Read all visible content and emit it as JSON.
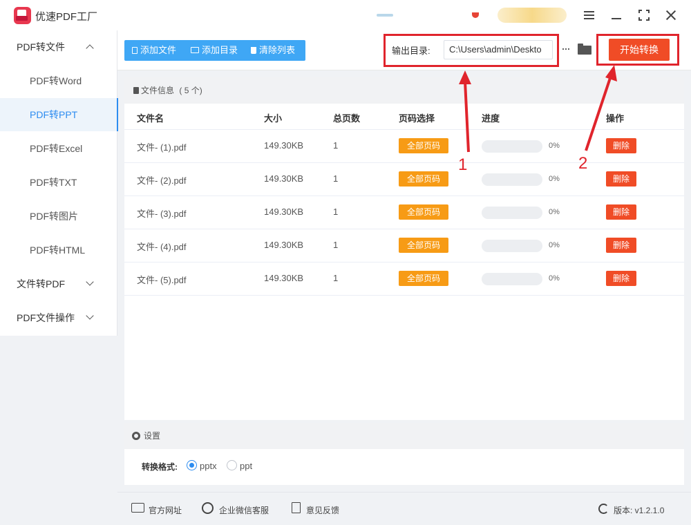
{
  "app": {
    "title": "优速PDF工厂"
  },
  "sidebar": {
    "groups": [
      {
        "label": "PDF转文件",
        "expanded": true,
        "items": [
          {
            "label": "PDF转Word"
          },
          {
            "label": "PDF转PPT",
            "active": true
          },
          {
            "label": "PDF转Excel"
          },
          {
            "label": "PDF转TXT"
          },
          {
            "label": "PDF转图片"
          },
          {
            "label": "PDF转HTML"
          }
        ]
      },
      {
        "label": "文件转PDF",
        "expanded": false
      },
      {
        "label": "PDF文件操作",
        "expanded": false
      }
    ]
  },
  "toolbar": {
    "add_file": "添加文件",
    "add_dir": "添加目录",
    "clear_list": "清除列表",
    "output_label": "输出目录:",
    "output_path": "C:\\Users\\admin\\Deskto",
    "more": "···",
    "start": "开始转换"
  },
  "file_panel": {
    "title": "文件信息",
    "count": "( 5 个)",
    "columns": {
      "name": "文件名",
      "size": "大小",
      "pages": "总页数",
      "page_select": "页码选择",
      "progress": "进度",
      "action": "操作"
    },
    "rows": [
      {
        "name": "文件- (1).pdf",
        "size": "149.30KB",
        "pages": "1",
        "page_select": "全部页码",
        "progress": 0,
        "progress_text": "0%",
        "action": "删除"
      },
      {
        "name": "文件- (2).pdf",
        "size": "149.30KB",
        "pages": "1",
        "page_select": "全部页码",
        "progress": 0,
        "progress_text": "0%",
        "action": "删除"
      },
      {
        "name": "文件- (3).pdf",
        "size": "149.30KB",
        "pages": "1",
        "page_select": "全部页码",
        "progress": 0,
        "progress_text": "0%",
        "action": "删除"
      },
      {
        "name": "文件- (4).pdf",
        "size": "149.30KB",
        "pages": "1",
        "page_select": "全部页码",
        "progress": 0,
        "progress_text": "0%",
        "action": "删除"
      },
      {
        "name": "文件- (5).pdf",
        "size": "149.30KB",
        "pages": "1",
        "page_select": "全部页码",
        "progress": 0,
        "progress_text": "0%",
        "action": "删除"
      }
    ]
  },
  "settings": {
    "title": "设置",
    "format_label": "转换格式:",
    "options": [
      {
        "label": "pptx",
        "checked": true
      },
      {
        "label": "ppt",
        "checked": false
      }
    ]
  },
  "footer": {
    "website": "官方网址",
    "wechat": "企业微信客服",
    "feedback": "意见反馈",
    "version": "版本: v1.2.1.0"
  },
  "annotations": {
    "one": "1",
    "two": "2"
  },
  "colors": {
    "accent": "#2d8cf0",
    "toolbar_blue": "#3fa7f5",
    "start_red": "#f04c26",
    "page_orange": "#f79b15",
    "annotation_red": "#e0242c"
  }
}
